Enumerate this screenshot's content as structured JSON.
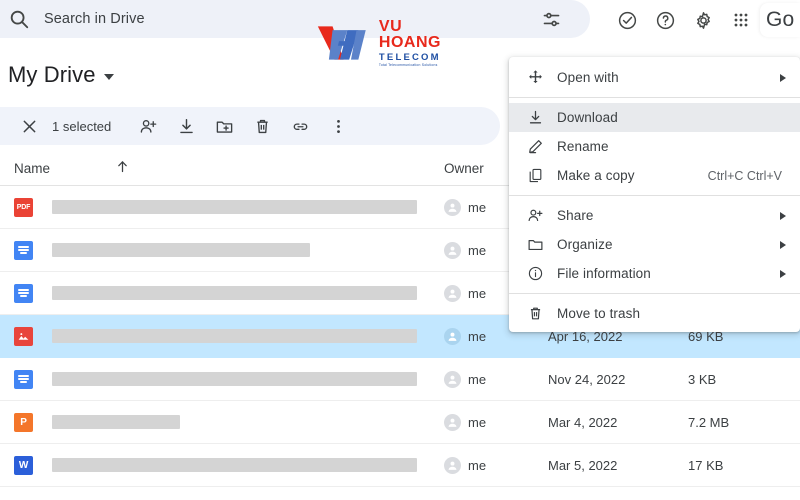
{
  "search": {
    "icon": "search-icon",
    "placeholder_text": "Search in Drive",
    "tune_icon": "tune-icon"
  },
  "top_icons": [
    {
      "name": "tasks-check-circle-icon",
      "glyph": "check-circle"
    },
    {
      "name": "help-icon",
      "glyph": "question-circle"
    },
    {
      "name": "settings-gear-icon",
      "glyph": "gear"
    },
    {
      "name": "apps-grid-icon",
      "glyph": "grid"
    }
  ],
  "account": {
    "label": "Go"
  },
  "watermark": {
    "top": "VU HOANG",
    "bottom": "TELECOM",
    "tagline": "Total Telecommunication Solutions",
    "red": "#e8291c",
    "blue": "#3f6cc0"
  },
  "header": {
    "title": "My Drive",
    "caret_icon": "chevron-down-icon"
  },
  "selection_toolbar": {
    "close_icon": "close-icon",
    "count_label": "1 selected",
    "buttons": [
      {
        "name": "share-add-person-button",
        "icon": "person-add-icon"
      },
      {
        "name": "download-button",
        "icon": "download-icon"
      },
      {
        "name": "move-to-folder-button",
        "icon": "folder-add-icon"
      },
      {
        "name": "delete-button",
        "icon": "trash-icon"
      },
      {
        "name": "get-link-button",
        "icon": "link-icon"
      },
      {
        "name": "more-actions-button",
        "icon": "more-vert-icon"
      }
    ]
  },
  "table": {
    "columns": {
      "name": "Name",
      "sort_icon": "arrow-up-icon",
      "owner": "Owner",
      "last_modified": "",
      "file_size": ""
    },
    "rows": [
      {
        "file_type": "pdf",
        "type_label": "PDF",
        "name_redacted": true,
        "name_width": 365,
        "owner": "me",
        "modified": "",
        "size": "",
        "selected": false
      },
      {
        "file_type": "doc",
        "type_label": "",
        "name_redacted": true,
        "name_width": 258,
        "owner": "me",
        "modified": "",
        "size": "",
        "selected": false
      },
      {
        "file_type": "doc",
        "type_label": "",
        "name_redacted": true,
        "name_width": 365,
        "owner": "me",
        "modified": "",
        "size": "",
        "selected": false
      },
      {
        "file_type": "img",
        "type_label": "",
        "name_redacted": true,
        "name_width": 365,
        "owner": "me",
        "modified": "Apr 16, 2022",
        "size": "69 KB",
        "selected": true
      },
      {
        "file_type": "doc",
        "type_label": "",
        "name_redacted": true,
        "name_width": 365,
        "owner": "me",
        "modified": "Nov 24, 2022",
        "size": "3 KB",
        "selected": false
      },
      {
        "file_type": "ppt",
        "type_label": "P",
        "name_redacted": true,
        "name_width": 128,
        "owner": "me",
        "modified": "Mar 4, 2022",
        "size": "7.2 MB",
        "selected": false
      },
      {
        "file_type": "word",
        "type_label": "W",
        "name_redacted": true,
        "name_width": 365,
        "owner": "me",
        "modified": "Mar 5, 2022",
        "size": "17 KB",
        "selected": false
      }
    ]
  },
  "context_menu": {
    "items": [
      {
        "id": "open-with",
        "label": "Open with",
        "icon": "open-with-arrows-icon",
        "shortcut": "",
        "submenu": true,
        "highlighted": false,
        "separator_after": true
      },
      {
        "id": "download",
        "label": "Download",
        "icon": "download-icon",
        "shortcut": "",
        "submenu": false,
        "highlighted": true,
        "separator_after": false
      },
      {
        "id": "rename",
        "label": "Rename",
        "icon": "pencil-icon",
        "shortcut": "",
        "submenu": false,
        "highlighted": false,
        "separator_after": false
      },
      {
        "id": "make-a-copy",
        "label": "Make a copy",
        "icon": "copy-icon",
        "shortcut": "Ctrl+C Ctrl+V",
        "submenu": false,
        "highlighted": false,
        "separator_after": true
      },
      {
        "id": "share",
        "label": "Share",
        "icon": "person-add-icon",
        "shortcut": "",
        "submenu": true,
        "highlighted": false,
        "separator_after": false
      },
      {
        "id": "organize",
        "label": "Organize",
        "icon": "folder-icon",
        "shortcut": "",
        "submenu": true,
        "highlighted": false,
        "separator_after": false
      },
      {
        "id": "file-information",
        "label": "File information",
        "icon": "info-circle-icon",
        "shortcut": "",
        "submenu": true,
        "highlighted": false,
        "separator_after": true
      },
      {
        "id": "move-to-trash",
        "label": "Move to trash",
        "icon": "trash-icon",
        "shortcut": "",
        "submenu": false,
        "highlighted": false,
        "separator_after": false
      }
    ]
  }
}
